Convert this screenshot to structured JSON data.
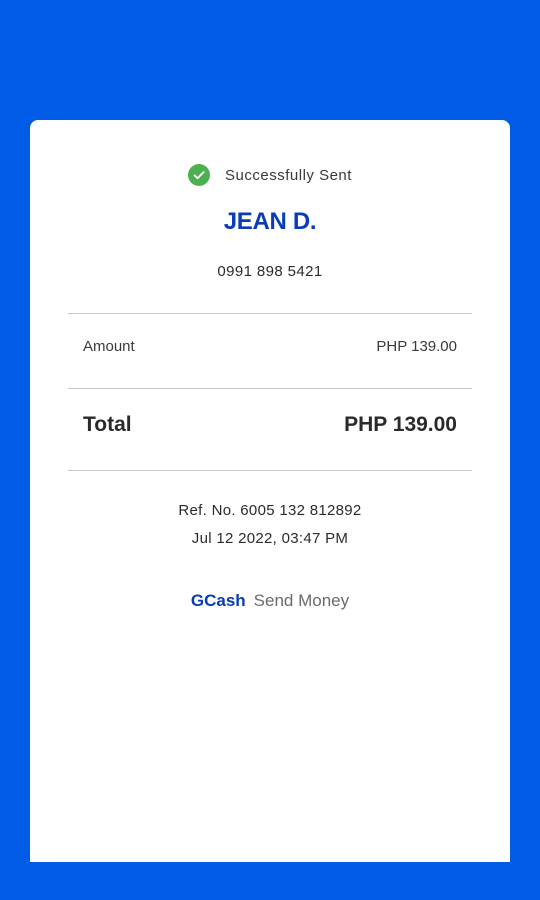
{
  "status": {
    "icon": "check-circle-icon",
    "icon_color": "#4caf50",
    "text": "Successfully Sent"
  },
  "recipient": {
    "name": "JEAN D.",
    "phone": "0991 898 5421"
  },
  "amount": {
    "label": "Amount",
    "value": "PHP 139.00"
  },
  "total": {
    "label": "Total",
    "value": "PHP 139.00"
  },
  "reference": {
    "ref_text": "Ref. No. 6005 132 812892",
    "datetime": "Jul 12 2022, 03:47 PM"
  },
  "footer": {
    "brand": "GCash",
    "service": "Send Money"
  },
  "colors": {
    "background": "#005ce6",
    "brand": "#0a3cb8",
    "success": "#4caf50",
    "card": "#ffffff"
  }
}
